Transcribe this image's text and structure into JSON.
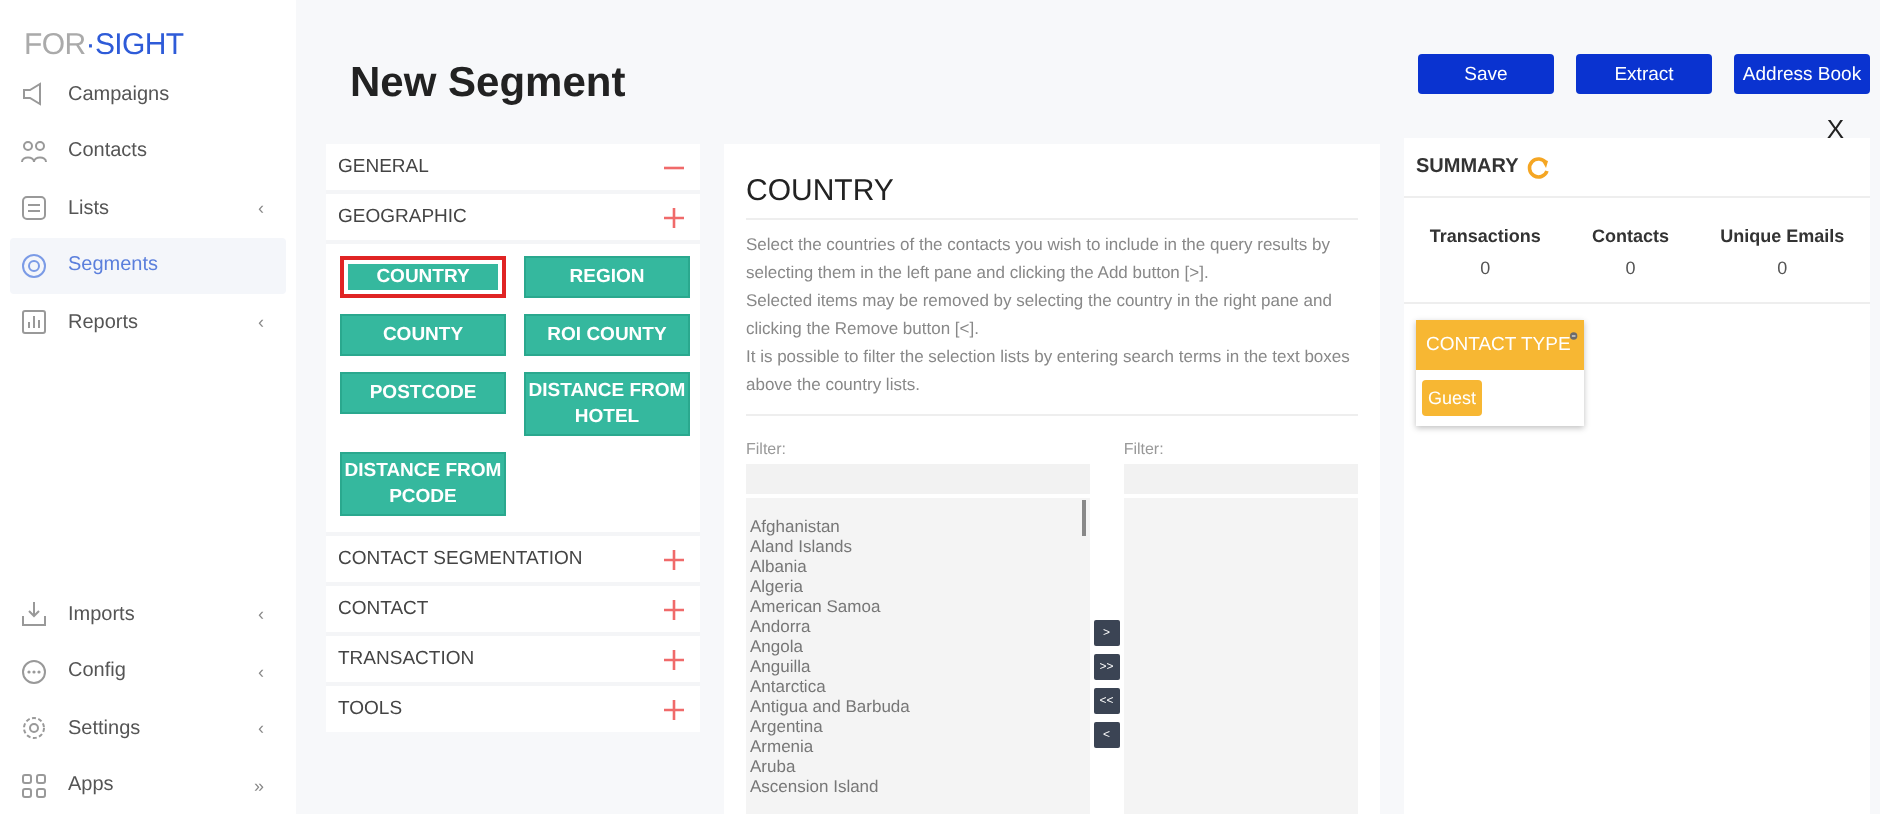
{
  "logo": {
    "part_1": "FOR",
    "part_2": "·SIGHT"
  },
  "sidebar": {
    "items": [
      {
        "label": "Campaigns",
        "selected": false
      },
      {
        "label": "Contacts",
        "selected": false
      },
      {
        "label": "Lists",
        "selected": false,
        "arrow": "‹"
      },
      {
        "label": "Segments",
        "selected": true
      },
      {
        "label": "Reports",
        "selected": false,
        "arrow": "‹"
      },
      {
        "label": "Imports",
        "selected": false,
        "arrow": "‹"
      },
      {
        "label": "Config",
        "selected": false,
        "arrow": "‹"
      },
      {
        "label": "Settings",
        "selected": false,
        "arrow": "‹"
      },
      {
        "label": "Apps",
        "selected": false,
        "arrow": "»"
      }
    ]
  },
  "page_title": "New Segment",
  "toolbar": {
    "buttons": [
      "Save",
      "Extract",
      "Address Book"
    ]
  },
  "close": "X",
  "categories": [
    {
      "label": "GENERAL",
      "expanded": true
    },
    {
      "label": "GEOGRAPHIC",
      "expanded": false,
      "options": [
        {
          "label": "COUNTRY",
          "selected": true
        },
        {
          "label": "REGION",
          "selected": false
        },
        {
          "label": "COUNTY",
          "selected": false
        },
        {
          "label": "ROI COUNTY",
          "selected": false
        },
        {
          "label": "POSTCODE",
          "selected": false
        },
        {
          "label": "DISTANCE FROM HOTEL",
          "selected": false
        },
        {
          "label": "DISTANCE FROM PCODE",
          "selected": false
        }
      ]
    },
    {
      "label": "CONTACT SEGMENTATION",
      "expanded": false
    },
    {
      "label": "CONTACT",
      "expanded": false
    },
    {
      "label": "TRANSACTION",
      "expanded": false
    },
    {
      "label": "TOOLS",
      "expanded": false
    }
  ],
  "detail": {
    "title": "COUNTRY",
    "description": [
      "Select the countries of the contacts you wish to include in the query results by selecting them in the left pane and clicking the Add button [>].",
      "Selected items may be removed by selecting the country in the right pane and clicking the Remove button [<].",
      "It is possible to filter the selection lists by entering search terms in the text boxes above the country lists."
    ],
    "available": {
      "filter_label": "Filter:",
      "items": [
        "Afghanistan",
        "Aland Islands",
        "Albania",
        "Algeria",
        "American Samoa",
        "Andorra",
        "Angola",
        "Anguilla",
        "Antarctica",
        "Antigua and Barbuda",
        "Argentina",
        "Armenia",
        "Aruba",
        "Ascension Island"
      ]
    },
    "transfer_buttons": [
      ">",
      ">>",
      "<<",
      "<"
    ],
    "chosen": {
      "filter_label": "Filter:"
    }
  },
  "summary": {
    "title": "SUMMARY",
    "stats": [
      {
        "label": "Transactions",
        "value": "0"
      },
      {
        "label": "Contacts",
        "value": "0"
      },
      {
        "label": "Unique Emails",
        "value": "0"
      }
    ],
    "criteria": [
      {
        "title": "CONTACT TYPE",
        "tags": [
          "Guest"
        ]
      }
    ]
  }
}
